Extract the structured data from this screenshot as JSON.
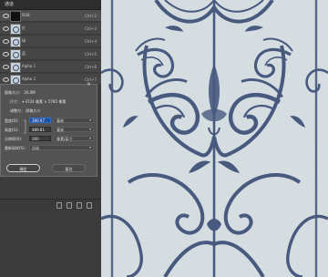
{
  "channels_panel": {
    "tab_label": "通道",
    "rows": [
      {
        "name": "RGB",
        "shortcut": "Ctrl+2",
        "thumb": "dark"
      },
      {
        "name": "红",
        "shortcut": "Ctrl+3",
        "thumb": "pattern"
      },
      {
        "name": "绿",
        "shortcut": "Ctrl+4",
        "thumb": "pattern"
      },
      {
        "name": "蓝",
        "shortcut": "Ctrl+5",
        "thumb": "pattern"
      },
      {
        "name": "Alpha 1",
        "shortcut": "Ctrl+6",
        "thumb": "pattern"
      },
      {
        "name": "Alpha 2",
        "shortcut": "Ctrl+7",
        "thumb": "pattern"
      }
    ]
  },
  "image_size_dialog": {
    "close": "×",
    "image_size": "图像大小：  26.0M",
    "dimensions": "尺寸：  ▾ 4724 像素 × 5785 像素",
    "fit_to": "调整为：  原稿大小",
    "width_label": "宽度(D):",
    "width_value": "399.97",
    "width_unit": "毫米",
    "height_label": "高度(G):",
    "height_value": "489.81",
    "height_unit": "毫米",
    "resolution_label": "分辨率(R):",
    "resolution_value": "300",
    "resolution_unit": "像素/英寸",
    "resample_label": "重新采样(S):",
    "resample_value": "自动",
    "ok_label": "确定",
    "reset_label": "复位"
  },
  "colors": {
    "pattern_navy": "#3d5079",
    "pattern_light": "#dfe6e9",
    "highlight_blue": "#1d4d9c"
  }
}
